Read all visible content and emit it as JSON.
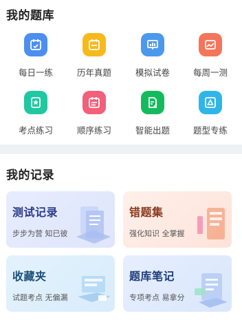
{
  "question_bank": {
    "title": "我的题库",
    "items": [
      {
        "label": "每日一练",
        "icon": "calendar-icon",
        "color": "#4d8ff0"
      },
      {
        "label": "历年真题",
        "icon": "calendar-icon",
        "color": "#f7b91c"
      },
      {
        "label": "模拟试卷",
        "icon": "presentation-chart-icon",
        "color": "#4c98ec"
      },
      {
        "label": "每周一测",
        "icon": "image-chart-icon",
        "color": "#f5755a"
      },
      {
        "label": "考点练习",
        "icon": "star-book-icon",
        "color": "#1fc8a0"
      },
      {
        "label": "顺序练习",
        "icon": "calendar-list-icon",
        "color": "#f2607a"
      },
      {
        "label": "智能出题",
        "icon": "document-pen-icon",
        "color": "#14bb5d"
      },
      {
        "label": "题型专练",
        "icon": "triangle-icon",
        "color": "#2fb6e8"
      }
    ]
  },
  "records": {
    "title": "我的记录",
    "cards": [
      {
        "title": "测试记录",
        "subtitle": "步步为营 知已彼"
      },
      {
        "title": "错题集",
        "subtitle": "强化知识 全掌握"
      },
      {
        "title": "收藏夹",
        "subtitle": "试题考点 无偏漏"
      },
      {
        "title": "题库笔记",
        "subtitle": "专项考点 易拿分"
      }
    ]
  }
}
